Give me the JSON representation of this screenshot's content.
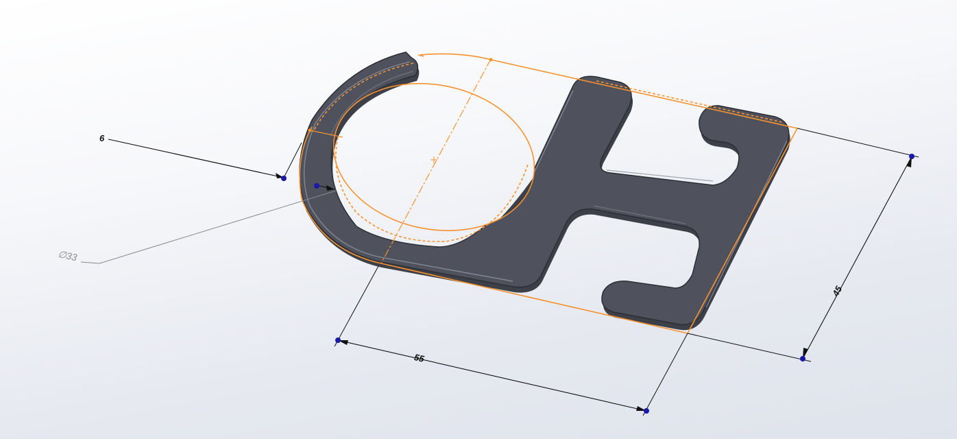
{
  "dimensions": {
    "thickness": "6",
    "diameter": "33",
    "diameter_symbol": "∅",
    "length": "55",
    "width": "45"
  },
  "colors": {
    "part_face": "#4f525d",
    "part_edge": "#2c2e35",
    "part_highlight": "#8c909c",
    "sketch_line": "#f7922e",
    "dimension_line": "#111111",
    "leader_line": "#8a8a8a",
    "endpoint": "#1a1aa8",
    "background_top": "#ffffff",
    "background_bottom": "#dfe3eb"
  }
}
